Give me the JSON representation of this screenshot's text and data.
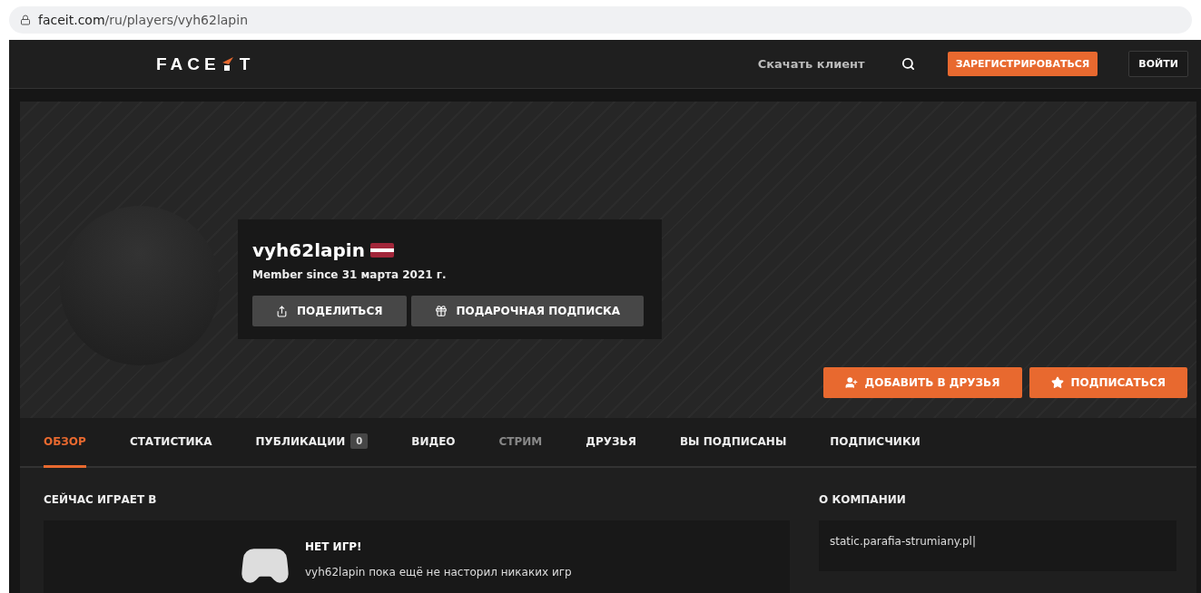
{
  "browser": {
    "url_host": "faceit.com",
    "url_path": "/ru/players/vyh62lapin"
  },
  "header": {
    "logo": "FACE",
    "logo_end": "T",
    "download": "Скачать клиент",
    "register": "ЗАРЕГИСТРИРОВАТЬСЯ",
    "login": "ВОЙТИ"
  },
  "profile": {
    "name": "vyh62lapin",
    "member_since": "Member since 31 марта 2021 г.",
    "share": "ПОДЕЛИТЬСЯ",
    "gift": "ПОДАРОЧНАЯ ПОДПИСКА",
    "add_friend": "ДОБАВИТЬ В ДРУЗЬЯ",
    "follow": "ПОДПИСАТЬСЯ"
  },
  "tabs": [
    {
      "label": "ОБЗОР",
      "selected": true,
      "disabled": false
    },
    {
      "label": "СТАТИСТИКА",
      "selected": false,
      "disabled": false
    },
    {
      "label": "ПУБЛИКАЦИИ",
      "selected": false,
      "disabled": false,
      "count": "0"
    },
    {
      "label": "ВИДЕО",
      "selected": false,
      "disabled": false
    },
    {
      "label": "СТРИМ",
      "selected": false,
      "disabled": true
    },
    {
      "label": "ДРУЗЬЯ",
      "selected": false,
      "disabled": false
    },
    {
      "label": "ВЫ ПОДПИСАНЫ",
      "selected": false,
      "disabled": false
    },
    {
      "label": "ПОДПИСЧИКИ",
      "selected": false,
      "disabled": false
    }
  ],
  "playing": {
    "title": "СЕЙЧАС ИГРАЕТ В",
    "empty_title": "НЕТ ИГР!",
    "empty_text": "vyh62lapin пока ещё не насторил никаких игр"
  },
  "about": {
    "title": "О КОМПАНИИ",
    "text": "static.parafia-strumiany.pl|"
  }
}
